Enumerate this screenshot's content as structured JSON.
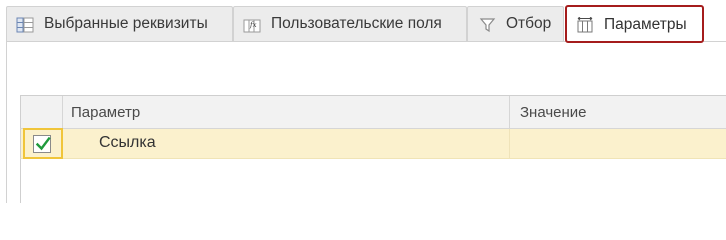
{
  "tabs": [
    {
      "label": "Выбранные реквизиты",
      "icon": "selected-fields-icon",
      "active": false
    },
    {
      "label": "Пользовательские поля",
      "icon": "custom-fields-icon",
      "active": false
    },
    {
      "label": "Отбор",
      "icon": "filter-icon",
      "active": false
    },
    {
      "label": "Параметры",
      "icon": "parameters-icon",
      "active": true
    }
  ],
  "grid": {
    "columns": [
      "Параметр",
      "Значение"
    ],
    "rows": [
      {
        "checked": true,
        "parameter": "Ссылка",
        "value": ""
      }
    ]
  },
  "colors": {
    "active_tab_border": "#a51c1c",
    "selected_row": "#fbf1cd",
    "focus_cell_border": "#f0c53a",
    "checkmark": "#1f9a3c"
  }
}
